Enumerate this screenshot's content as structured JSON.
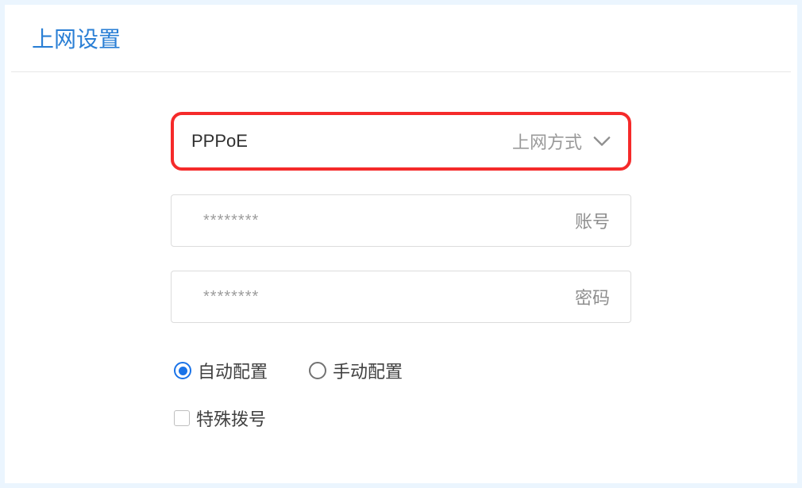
{
  "panel": {
    "title": "上网设置"
  },
  "connection": {
    "mode_value": "PPPoE",
    "mode_label": "上网方式",
    "account_value": "********",
    "account_label": "账号",
    "password_value": "********",
    "password_label": "密码"
  },
  "config": {
    "auto_label": "自动配置",
    "manual_label": "手动配置",
    "selected": "auto"
  },
  "special_dial": {
    "label": "特殊拨号",
    "checked": false
  }
}
